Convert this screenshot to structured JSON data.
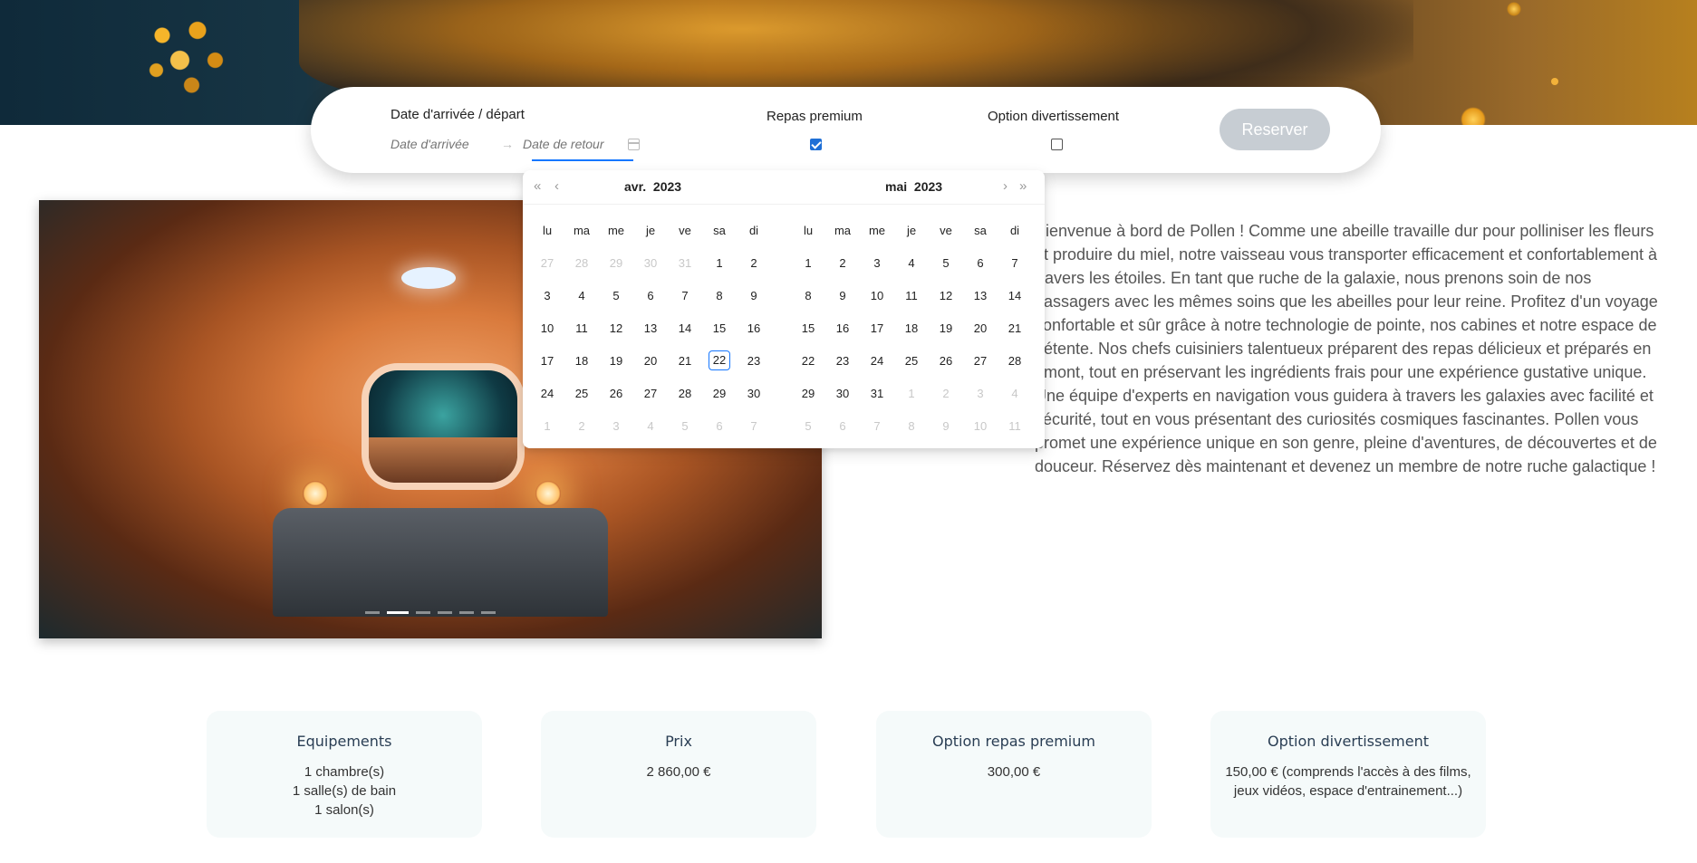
{
  "booking": {
    "dates_label": "Date d'arrivée / départ",
    "arrival_placeholder": "Date d'arrivée",
    "return_placeholder": "Date de retour",
    "range_separator": "→",
    "premium_label": "Repas premium",
    "premium_checked": true,
    "entertainment_label": "Option divertissement",
    "entertainment_checked": false,
    "reserve_label": "Reserver"
  },
  "description": "Bienvenue à bord de Pollen ! Comme une abeille travaille dur pour polliniser les fleurs et produire du miel, notre vaisseau vous transporter efficacement et confortablement à travers les étoiles. En tant que ruche de la galaxie, nous prenons soin de nos passagers avec les mêmes soins que les abeilles pour leur reine. Profitez d'un voyage confortable et sûr grâce à notre technologie de pointe, nos cabines et notre espace de détente. Nos chefs cuisiniers talentueux préparent des repas délicieux et préparés en amont, tout en préservant les ingrédients frais pour une expérience gustative unique. Une équipe d'experts en navigation vous guidera à travers les galaxies avec facilité et sécurité, tout en vous présentant des curiosités cosmiques fascinantes. Pollen vous promet une expérience unique en son genre, pleine d'aventures, de découvertes et de douceur. Réservez dès maintenant et devenez un membre de notre ruche galactique !",
  "carousel": {
    "slide_count": 6,
    "active_slide": 2
  },
  "picker": {
    "weekdays": [
      "lu",
      "ma",
      "me",
      "je",
      "ve",
      "sa",
      "di"
    ],
    "left": {
      "month": "avr.",
      "year": "2023",
      "weeks": [
        [
          "27",
          "28",
          "29",
          "30",
          "31",
          "1",
          "2"
        ],
        [
          "3",
          "4",
          "5",
          "6",
          "7",
          "8",
          "9"
        ],
        [
          "10",
          "11",
          "12",
          "13",
          "14",
          "15",
          "16"
        ],
        [
          "17",
          "18",
          "19",
          "20",
          "21",
          "22",
          "23"
        ],
        [
          "24",
          "25",
          "26",
          "27",
          "28",
          "29",
          "30"
        ],
        [
          "1",
          "2",
          "3",
          "4",
          "5",
          "6",
          "7"
        ]
      ],
      "muted": [
        [
          0,
          0
        ],
        [
          0,
          1
        ],
        [
          0,
          2
        ],
        [
          0,
          3
        ],
        [
          0,
          4
        ],
        [
          5,
          0
        ],
        [
          5,
          1
        ],
        [
          5,
          2
        ],
        [
          5,
          3
        ],
        [
          5,
          4
        ],
        [
          5,
          5
        ],
        [
          5,
          6
        ]
      ],
      "today": [
        3,
        5
      ]
    },
    "right": {
      "month": "mai",
      "year": "2023",
      "weeks": [
        [
          "1",
          "2",
          "3",
          "4",
          "5",
          "6",
          "7"
        ],
        [
          "8",
          "9",
          "10",
          "11",
          "12",
          "13",
          "14"
        ],
        [
          "15",
          "16",
          "17",
          "18",
          "19",
          "20",
          "21"
        ],
        [
          "22",
          "23",
          "24",
          "25",
          "26",
          "27",
          "28"
        ],
        [
          "29",
          "30",
          "31",
          "1",
          "2",
          "3",
          "4"
        ],
        [
          "5",
          "6",
          "7",
          "8",
          "9",
          "10",
          "11"
        ]
      ],
      "muted": [
        [
          4,
          3
        ],
        [
          4,
          4
        ],
        [
          4,
          5
        ],
        [
          4,
          6
        ],
        [
          5,
          0
        ],
        [
          5,
          1
        ],
        [
          5,
          2
        ],
        [
          5,
          3
        ],
        [
          5,
          4
        ],
        [
          5,
          5
        ],
        [
          5,
          6
        ]
      ],
      "today": null
    }
  },
  "cards": [
    {
      "title": "Equipements",
      "lines": [
        "1 chambre(s)",
        "1 salle(s) de bain",
        "1 salon(s)"
      ]
    },
    {
      "title": "Prix",
      "lines": [
        "2 860,00 €"
      ]
    },
    {
      "title": "Option repas premium",
      "lines": [
        "300,00 €"
      ]
    },
    {
      "title": "Option divertissement",
      "lines": [
        "150,00 € (comprends l'accès à des films,",
        "jeux vidéos, espace d'entrainement...)"
      ]
    }
  ],
  "colors": {
    "accent": "#1677ff",
    "checkbox": "#1f6fd6",
    "reserve_disabled": "#c7cdd3",
    "card_bg": "#f5fafa"
  }
}
